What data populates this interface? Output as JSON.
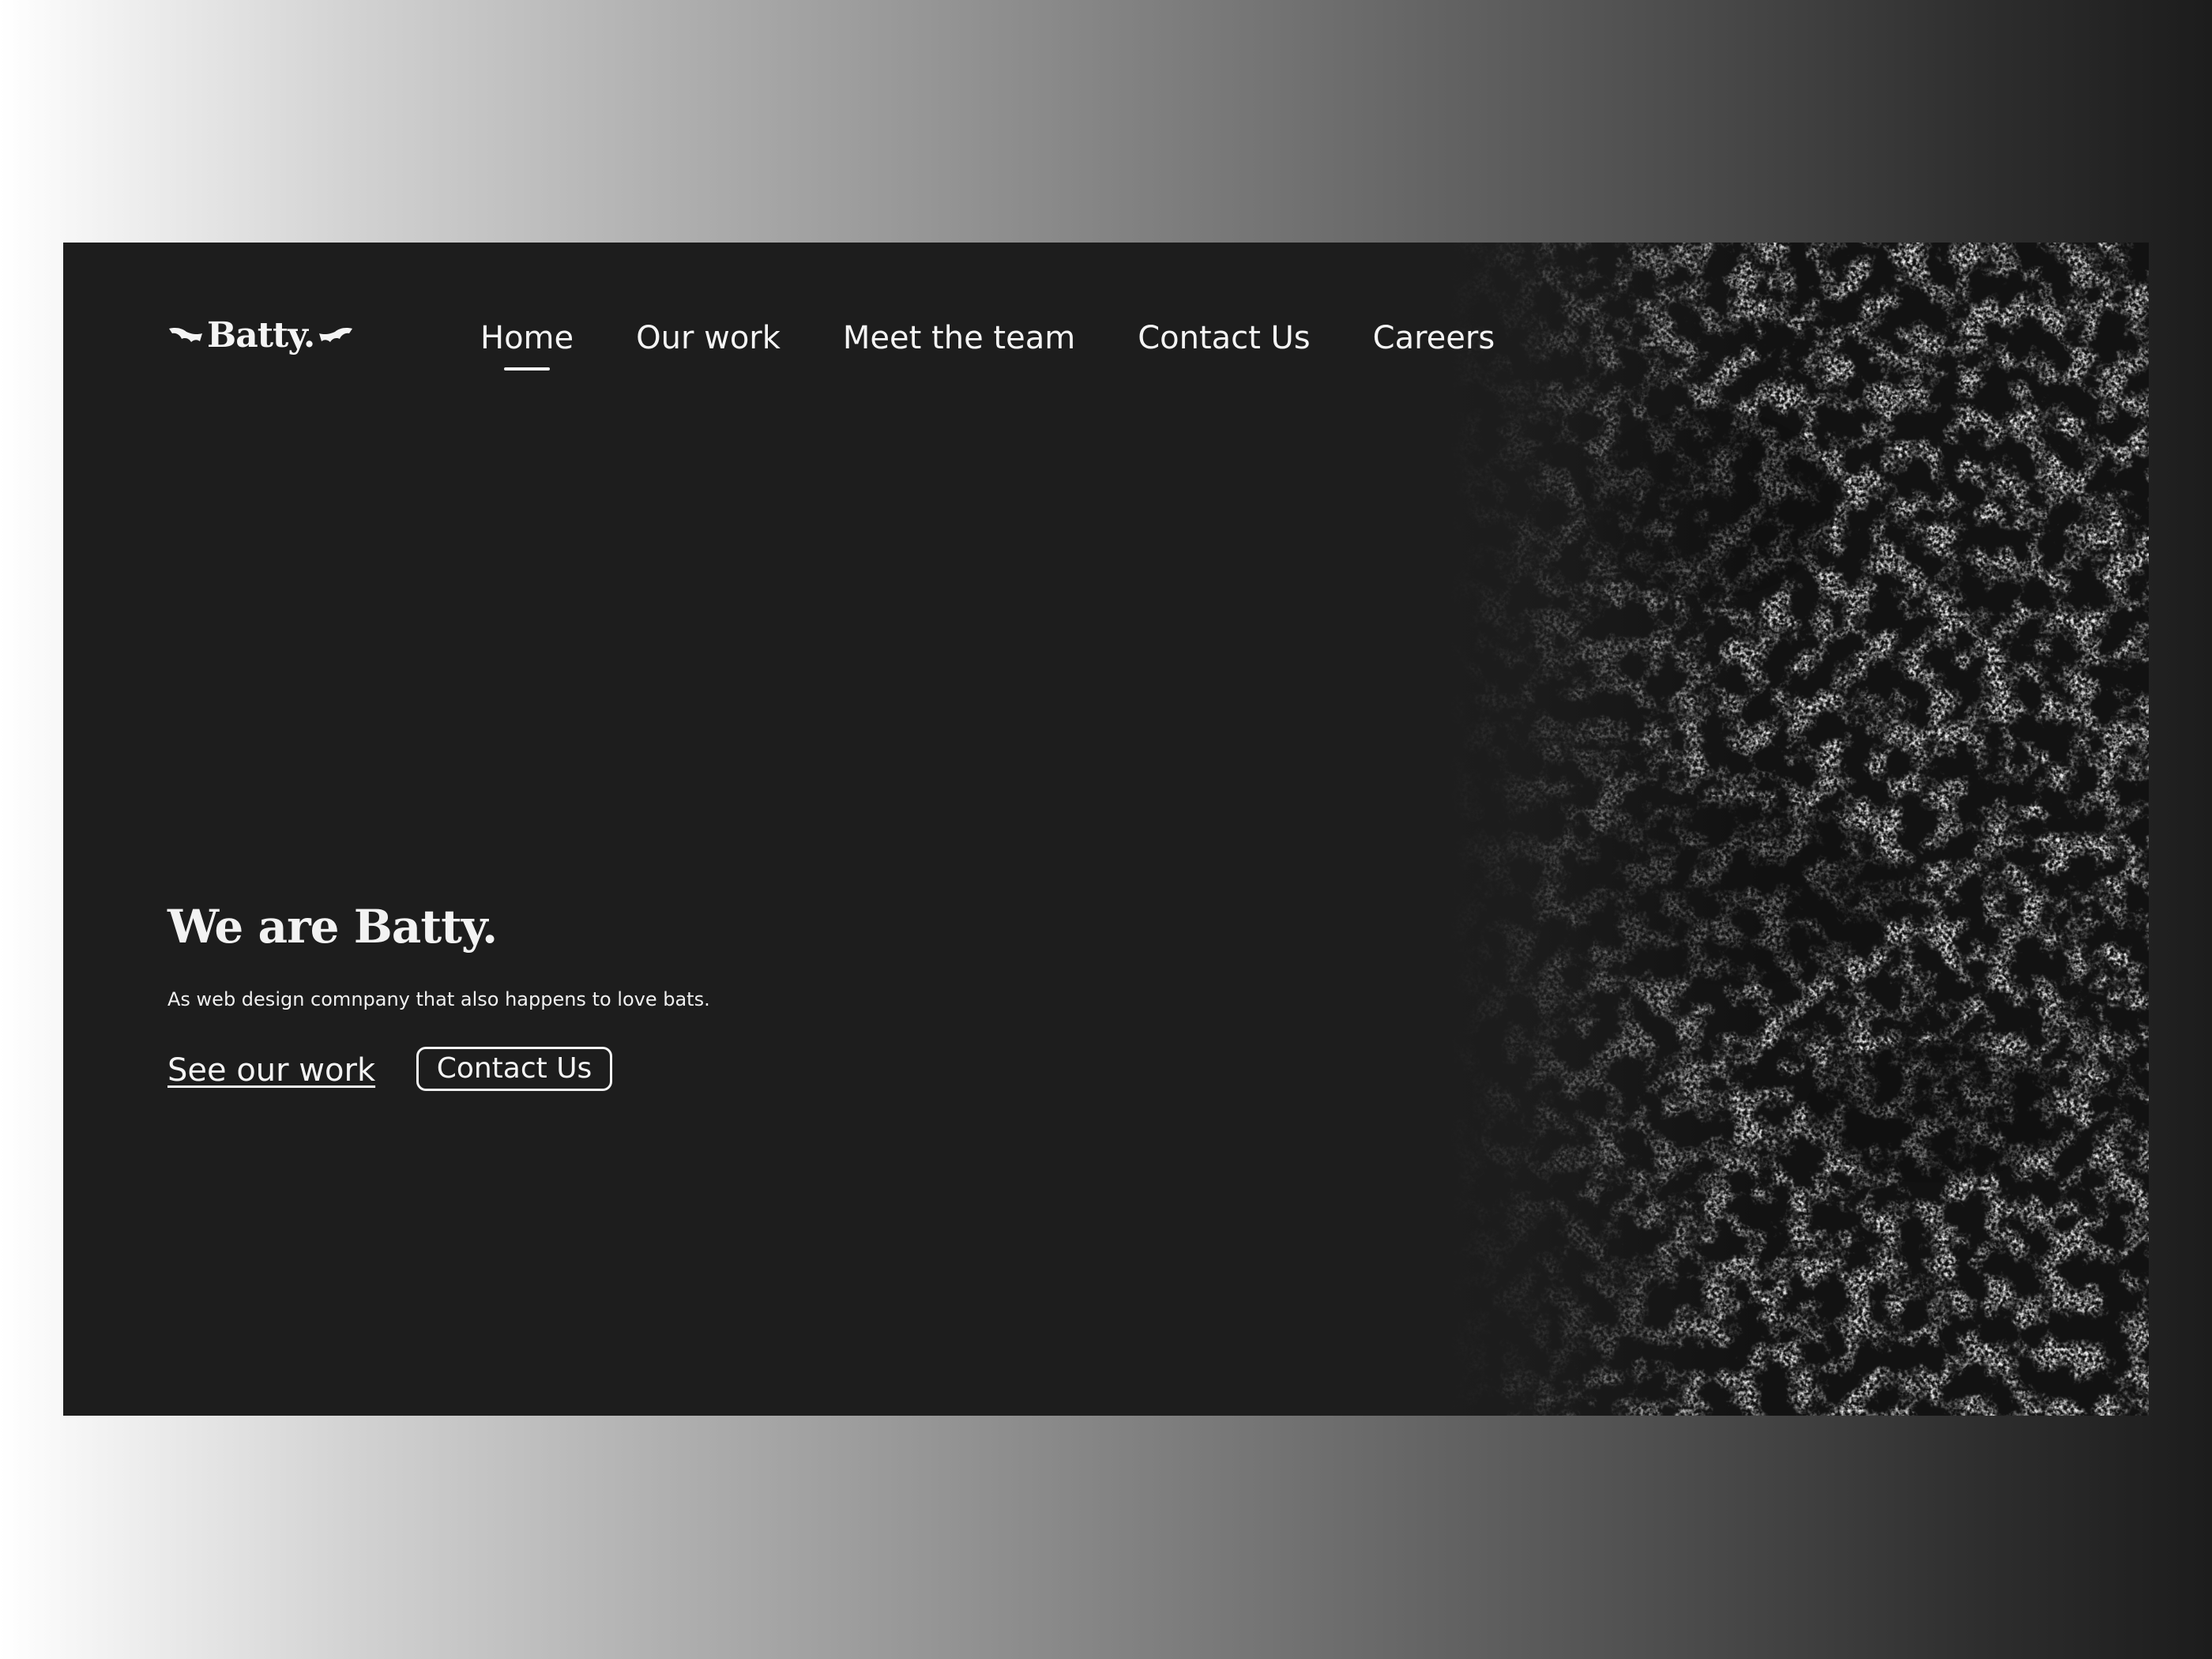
{
  "brand": {
    "name": "Batty.",
    "logo_icon": "bat-wing-icon"
  },
  "nav": {
    "items": [
      {
        "label": "Home",
        "active": true
      },
      {
        "label": "Our work",
        "active": false
      },
      {
        "label": "Meet the team",
        "active": false
      },
      {
        "label": "Contact Us",
        "active": false
      },
      {
        "label": "Careers",
        "active": false
      }
    ]
  },
  "hero": {
    "title": "We are Batty.",
    "subtitle": "As web design comnpany that also happens to love bats.",
    "link_label": "See our work",
    "button_label": "Contact Us"
  },
  "colors": {
    "page_background_light": "#ffffff",
    "page_background_dark": "#1c1c1c",
    "panel_background": "#1d1d1d",
    "text": "#f4f4f4"
  }
}
